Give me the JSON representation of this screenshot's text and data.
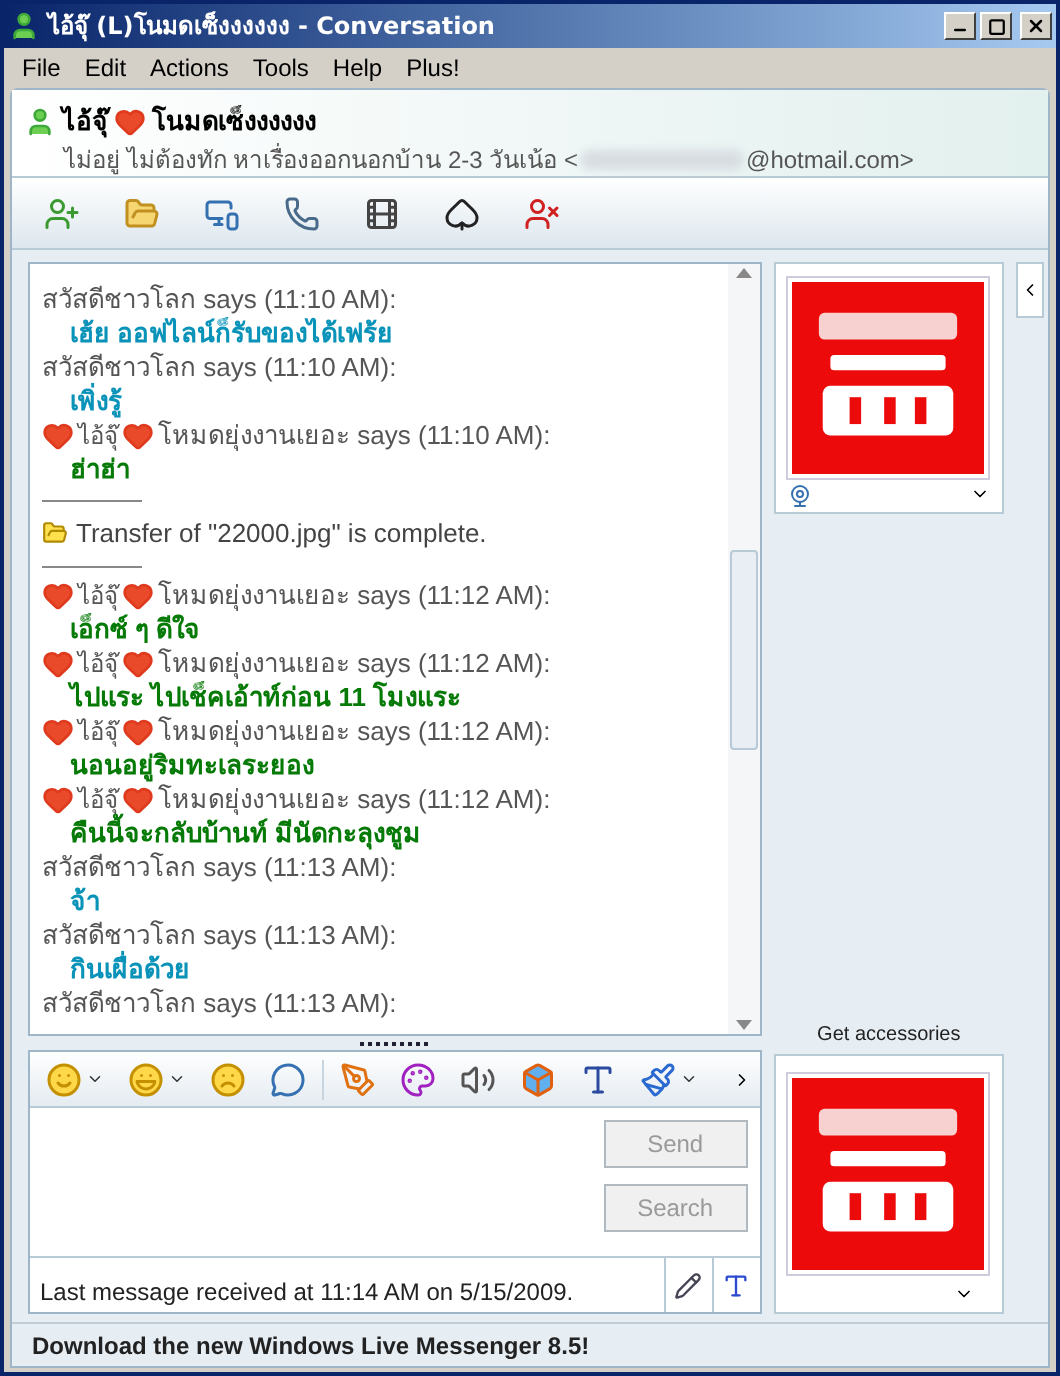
{
  "window": {
    "title": "ไอ้จุ๊ (L)โนมดเซ็งงงงงง - Conversation"
  },
  "menu": [
    "File",
    "Edit",
    "Actions",
    "Tools",
    "Help",
    "Plus!"
  ],
  "contact": {
    "name_1": "ไอ้จุ๊",
    "name_2": "โนมดเซ็งงงงงง",
    "status": "ไม่อยู่ ไม่ต้องทัก หาเรื่องออกนอกบ้าน 2-3 วันเน้อ <",
    "email_end": "@hotmail.com>"
  },
  "messages": [
    {
      "kind": "plain",
      "sender": "สวัสดีชาวโลก says (11:10 AM):",
      "text": "เฮ้ย ออฟไลน์ก็รับของได้เฟร้ย",
      "color": "#0a93b8"
    },
    {
      "kind": "plain",
      "sender": "สวัสดีชาวโลก says (11:10 AM):",
      "text": "เพิ่งรู้",
      "color": "#0a93b8"
    },
    {
      "kind": "hearts",
      "name_1": "ไอ้จุ๊",
      "sender": "โหมดยุ่งงานเยอะ says (11:10 AM):",
      "text": "ฮ่าฮ่า",
      "color": "#067a06"
    },
    {
      "kind": "transfer",
      "text": "Transfer of \"22000.jpg\" is complete."
    },
    {
      "kind": "hearts",
      "name_1": "ไอ้จุ๊",
      "sender": "โหมดยุ่งงานเยอะ says (11:12 AM):",
      "text": "เอ็กซ์ ๆ ดีใจ",
      "color": "#067a06"
    },
    {
      "kind": "hearts",
      "name_1": "ไอ้จุ๊",
      "sender": "โหมดยุ่งงานเยอะ says (11:12 AM):",
      "text": "ไปแระ ไปเช็คเอ้าท์ก่อน 11 โมงแระ",
      "color": "#067a06"
    },
    {
      "kind": "hearts",
      "name_1": "ไอ้จุ๊",
      "sender": "โหมดยุ่งงานเยอะ says (11:12 AM):",
      "text": "นอนอยู่ริมทะเลระยอง",
      "color": "#067a06"
    },
    {
      "kind": "hearts",
      "name_1": "ไอ้จุ๊",
      "sender": "โหมดยุ่งงานเยอะ says (11:12 AM):",
      "text": "คืนนี้จะกลับบ้านท์ มีนัดกะลุงชูม",
      "color": "#067a06"
    },
    {
      "kind": "plain",
      "sender": "สวัสดีชาวโลก says (11:13 AM):",
      "text": "จ้า",
      "color": "#0a93b8"
    },
    {
      "kind": "plain",
      "sender": "สวัสดีชาวโลก says (11:13 AM):",
      "text": "กินเผื่อด้วย",
      "color": "#0a93b8"
    },
    {
      "kind": "plain",
      "sender": "สวัสดีชาวโลก says (11:13 AM):"
    }
  ],
  "input": {
    "send": "Send",
    "search": "Search",
    "send_disabled": true,
    "search_disabled": true
  },
  "status_line": "Last message received at 11:14 AM on 5/15/2009.",
  "accessories_link": "Get accessories",
  "banner": "Download the new Windows Live Messenger 8.5!"
}
